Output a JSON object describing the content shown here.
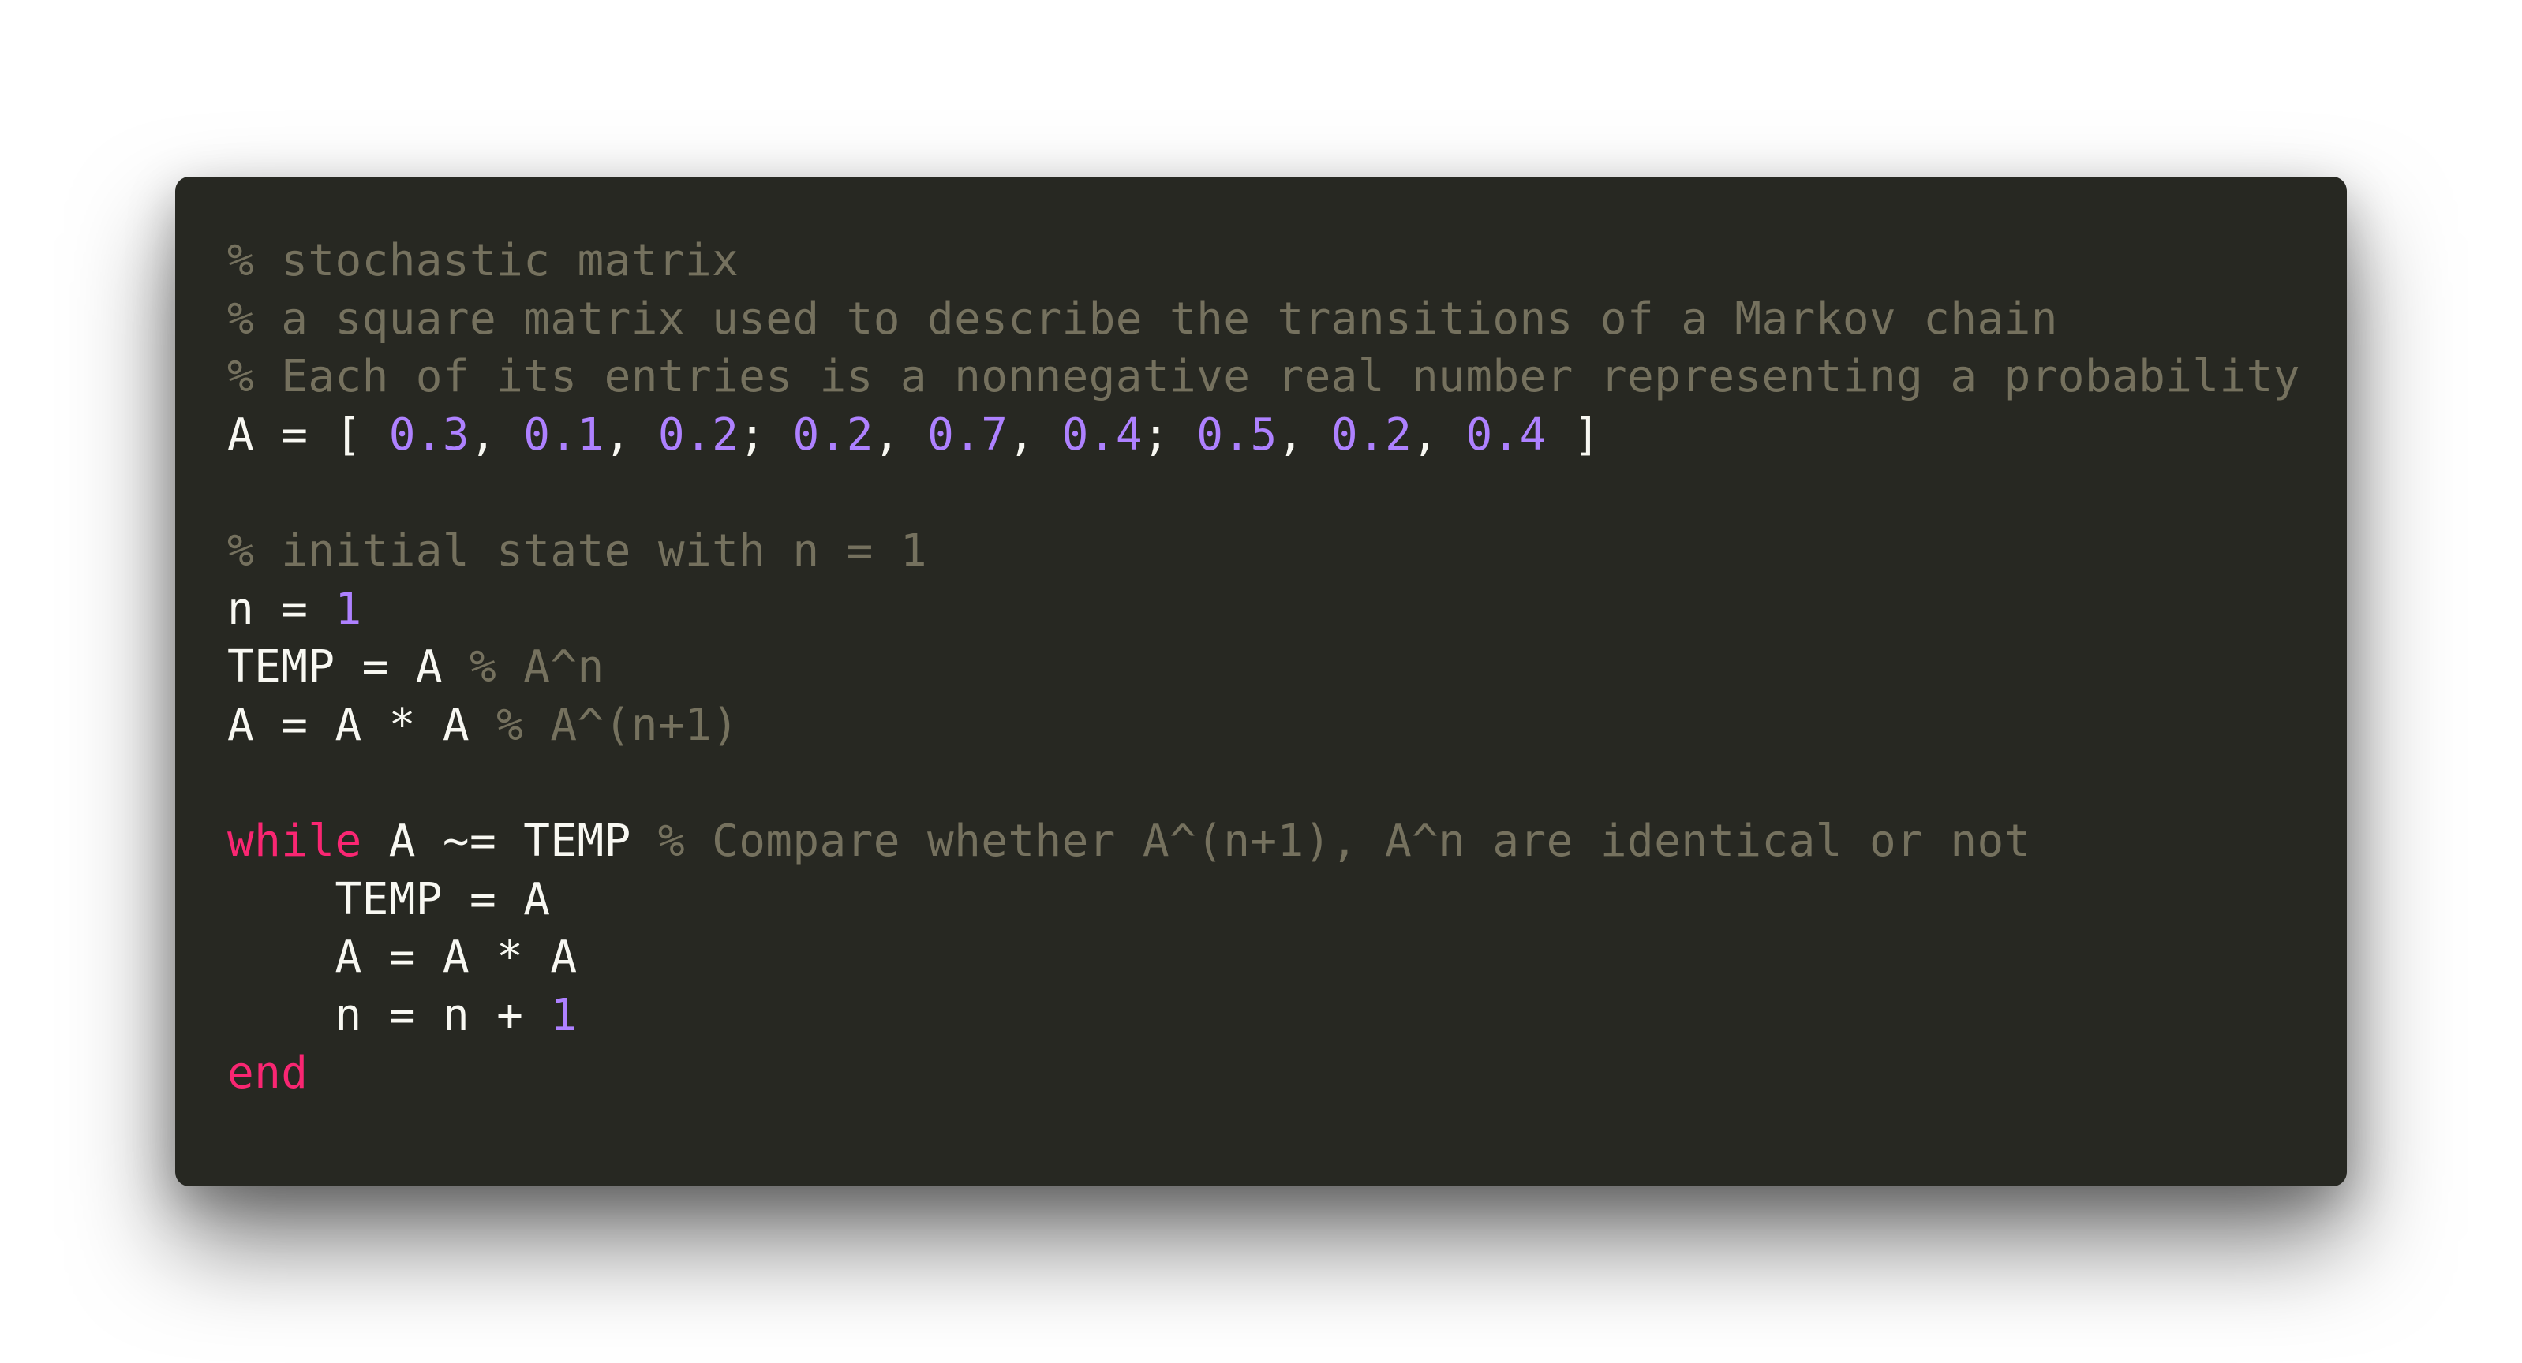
{
  "code": {
    "language": "MATLAB",
    "theme_colors": {
      "background": "#272822",
      "text": "#f8f8f2",
      "comment": "#75715e",
      "number": "#ae81ff",
      "keyword": "#f92672",
      "page_background": "#ffffff"
    },
    "lines": [
      [
        {
          "t": "% stochastic matrix",
          "c": "cmt"
        }
      ],
      [
        {
          "t": "% a square matrix used to describe the transitions of a Markov chain",
          "c": "cmt"
        }
      ],
      [
        {
          "t": "% Each of its entries is a nonnegative real number representing a probability",
          "c": "cmt"
        }
      ],
      [
        {
          "t": "A = [ ",
          "c": "plain"
        },
        {
          "t": "0.3",
          "c": "num"
        },
        {
          "t": ", ",
          "c": "plain"
        },
        {
          "t": "0.1",
          "c": "num"
        },
        {
          "t": ", ",
          "c": "plain"
        },
        {
          "t": "0.2",
          "c": "num"
        },
        {
          "t": "; ",
          "c": "plain"
        },
        {
          "t": "0.2",
          "c": "num"
        },
        {
          "t": ", ",
          "c": "plain"
        },
        {
          "t": "0.7",
          "c": "num"
        },
        {
          "t": ", ",
          "c": "plain"
        },
        {
          "t": "0.4",
          "c": "num"
        },
        {
          "t": "; ",
          "c": "plain"
        },
        {
          "t": "0.5",
          "c": "num"
        },
        {
          "t": ", ",
          "c": "plain"
        },
        {
          "t": "0.2",
          "c": "num"
        },
        {
          "t": ", ",
          "c": "plain"
        },
        {
          "t": "0.4",
          "c": "num"
        },
        {
          "t": " ]",
          "c": "plain"
        }
      ],
      [],
      [
        {
          "t": "% initial state with n = 1",
          "c": "cmt"
        }
      ],
      [
        {
          "t": "n = ",
          "c": "plain"
        },
        {
          "t": "1",
          "c": "num"
        }
      ],
      [
        {
          "t": "TEMP = A ",
          "c": "plain"
        },
        {
          "t": "% A^n",
          "c": "cmt"
        }
      ],
      [
        {
          "t": "A = A * A ",
          "c": "plain"
        },
        {
          "t": "% A^(n+1)",
          "c": "cmt"
        }
      ],
      [],
      [
        {
          "t": "while",
          "c": "kw"
        },
        {
          "t": " A ~= TEMP ",
          "c": "plain"
        },
        {
          "t": "% Compare whether A^(n+1), A^n are identical or not",
          "c": "cmt"
        }
      ],
      [
        {
          "t": "    TEMP = A",
          "c": "plain"
        }
      ],
      [
        {
          "t": "    A = A * A",
          "c": "plain"
        }
      ],
      [
        {
          "t": "    n = n + ",
          "c": "plain"
        },
        {
          "t": "1",
          "c": "num"
        }
      ],
      [
        {
          "t": "end",
          "c": "kw"
        }
      ]
    ]
  }
}
